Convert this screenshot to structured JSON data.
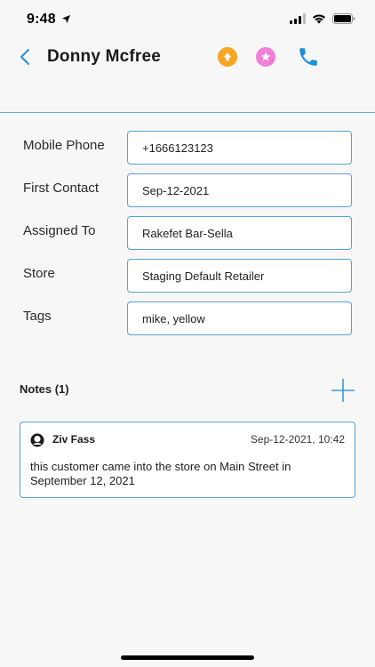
{
  "status_bar": {
    "time": "9:48"
  },
  "header": {
    "title": "Donny Mcfree",
    "colors": {
      "upload": "#f5a623",
      "favorite": "#f07fd8",
      "phone": "#1a8fd8"
    }
  },
  "fields": [
    {
      "label": "Mobile Phone",
      "value": "+1666123123"
    },
    {
      "label": "First Contact",
      "value": "Sep-12-2021"
    },
    {
      "label": "Assigned To",
      "value": "Rakefet Bar-Sella"
    },
    {
      "label": "Store",
      "value": "Staging Default Retailer"
    },
    {
      "label": "Tags",
      "value": "mike, yellow"
    }
  ],
  "notes": {
    "title": "Notes (1)",
    "items": [
      {
        "author": "Ziv Fass",
        "date": "Sep-12-2021, 10:42",
        "body": "this customer came into the store on Main Street in September 12, 2021"
      }
    ]
  },
  "colors": {
    "accent": "#5aa1d0",
    "background": "#f7f7f7"
  }
}
